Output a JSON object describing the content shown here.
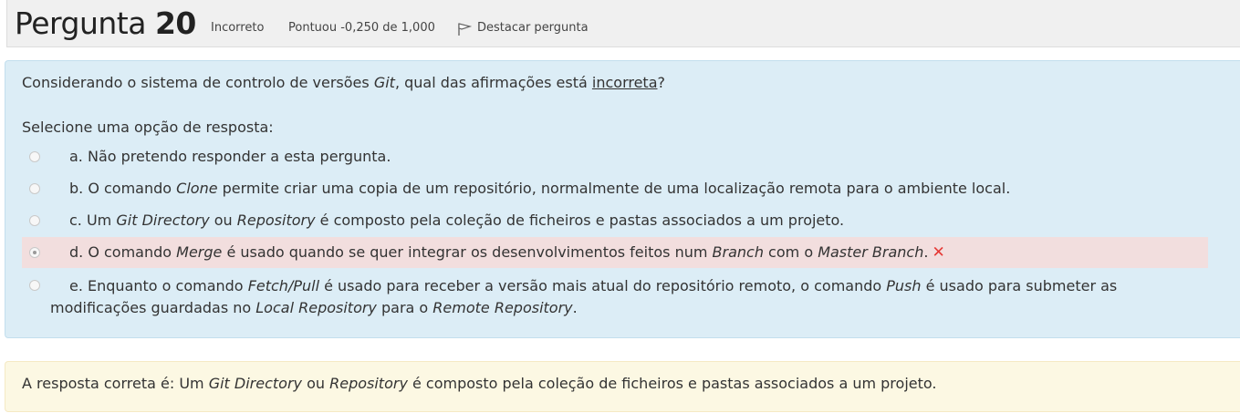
{
  "header": {
    "title_word": "Pergunta",
    "number": "20",
    "status": "Incorreto",
    "score": "Pontuou -0,250 de 1,000",
    "flag_label": "Destacar pergunta"
  },
  "question": {
    "text_before": "Considerando o sistema de controlo de versões ",
    "text_git": "Git",
    "text_middle": ", qual das afirmações está ",
    "text_incorrect": "incorreta",
    "text_end": "?",
    "prompt": "Selecione uma opção de resposta:"
  },
  "options": {
    "a": {
      "text": "a. Não pretendo responder a esta pergunta."
    },
    "b": {
      "p1": "b. O comando ",
      "i1": "Clone",
      "p2": " permite criar uma copia de um repositório, normalmente de uma localização remota para o ambiente local."
    },
    "c": {
      "p1": "c. Um ",
      "i1": "Git Directory",
      "p2": " ou ",
      "i2": "Repository",
      "p3": " é composto pela coleção de ficheiros e pastas associados a um projeto."
    },
    "d": {
      "p1": "d. O comando ",
      "i1": "Merge",
      "p2": " é usado quando se quer integrar os desenvolvimentos feitos num ",
      "i2": "Branch",
      "p3": " com o ",
      "i3": "Master Branch",
      "p4": ".",
      "mark": "✕"
    },
    "e": {
      "p1": "e. Enquanto o comando ",
      "i1": "Fetch/Pull",
      "p2": " é usado para receber a versão mais atual do repositório remoto, o comando ",
      "i2": "Push",
      "p3": " é usado para submeter as modificações guardadas no ",
      "i3": "Local Repository",
      "p4": " para o ",
      "i4": "Remote Repository",
      "p5": "."
    }
  },
  "feedback": {
    "p1": "A resposta correta é: Um ",
    "i1": "Git Directory",
    "p2": " ou ",
    "i2": "Repository",
    "p3": " é composto pela coleção de ficheiros e pastas associados a um projeto."
  },
  "colors": {
    "info_bg": "#dcedf6",
    "wrong_bg": "#f2dede",
    "feedback_bg": "#fcf8e3",
    "x_mark": "#e53935"
  }
}
